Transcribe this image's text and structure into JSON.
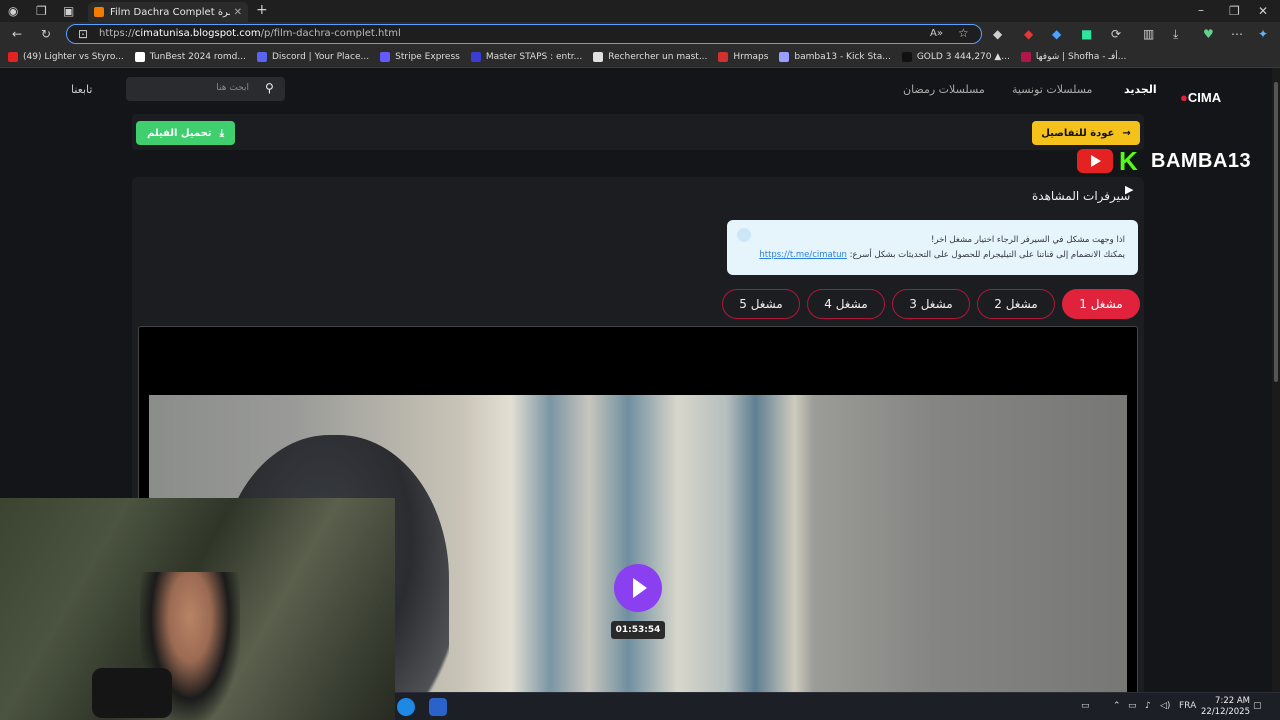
{
  "browser": {
    "tab_title": "Film Dachra Complet الرعب دشرة",
    "url_prefix": "https://",
    "url_domain": "cimatunisa.blogspot.com",
    "url_path": "/p/film-dachra-complet.html",
    "bookmarks": [
      {
        "label": "(49) Lighter vs Styro...",
        "color": "#e52222"
      },
      {
        "label": "TunBest 2024 romd...",
        "color": "#ffffff"
      },
      {
        "label": "Discord | Your Place...",
        "color": "#5865f2"
      },
      {
        "label": "Stripe Express",
        "color": "#635bff"
      },
      {
        "label": "Master STAPS : entr...",
        "color": "#3b3bd6"
      },
      {
        "label": "Rechercher un mast...",
        "color": "#e0e0e0"
      },
      {
        "label": "Hrmaps",
        "color": "#d32f2f"
      },
      {
        "label": "bamba13 - Kick Sta...",
        "color": "#9aa0ff"
      },
      {
        "label": "GOLD 3 444,270 ▲...",
        "color": "#111111"
      },
      {
        "label": "شوفها | Shofha - أفـ...",
        "color": "#b0174a"
      }
    ]
  },
  "site": {
    "logo_text": "CIMA",
    "nav": {
      "new": "الجديد",
      "tunisian_series": "مسلسلات تونسية",
      "ramadan_series": "مسلسلات رمضان"
    },
    "search_placeholder": "ابحث هنا",
    "follow_label": "تابعنا",
    "download_button": "تحميل الفيلم",
    "back_button": "عودة للتفاصيل",
    "streamer_name": "BAMBA13",
    "servers_title": "سيرفرات المشاهدة",
    "notice_line1": "اذا وجهت مشكل في السيرفر الرجاء اختيار مشغل اخر!",
    "notice_line2": "يمكنك الانضمام إلى قناتنا على التيليجرام للحصول على التحديثات بشكل أسرع:",
    "notice_link": "https://t.me/cimatun",
    "servers": [
      "مشغل 1",
      "مشغل 2",
      "مشغل 3",
      "مشغل 4",
      "مشغل 5"
    ],
    "active_server": 0,
    "video_duration": "01:53:54"
  },
  "taskbar": {
    "lang": "FRA",
    "time": "7:22 AM",
    "date": "22/12/2025"
  },
  "colors": {
    "accent_red": "#e0223d",
    "download_green": "#3fcf6f",
    "back_yellow": "#f5c21b",
    "play_purple": "#8a3ff0"
  }
}
